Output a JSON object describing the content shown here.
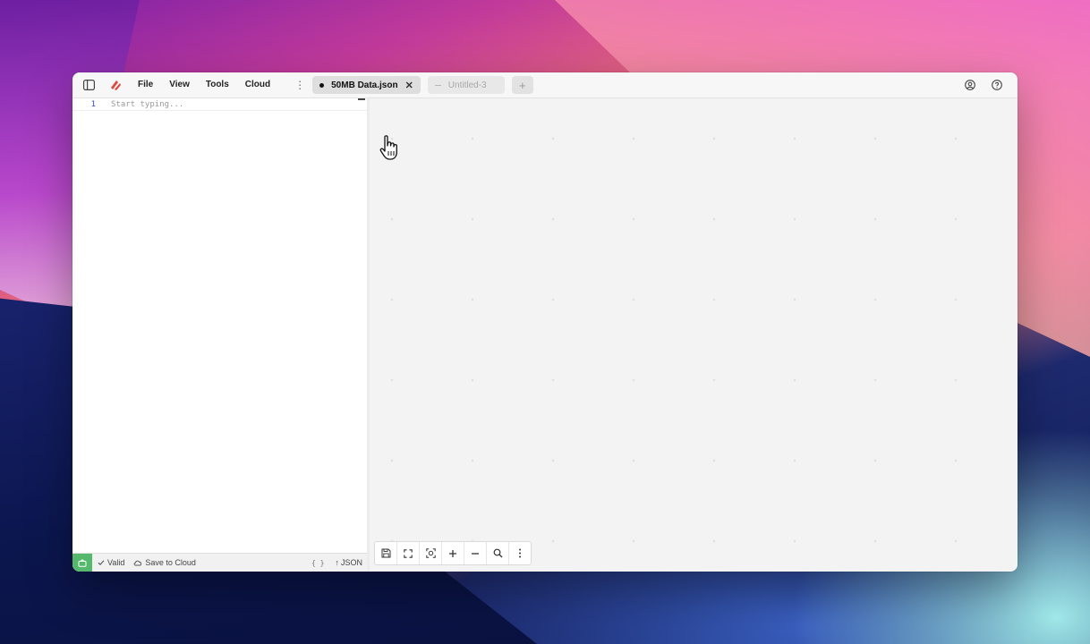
{
  "window": {
    "menu": [
      "File",
      "View",
      "Tools",
      "Cloud"
    ],
    "tabs": [
      {
        "label": "50MB Data.json",
        "active": true
      },
      {
        "label": "Untitled-3",
        "active": false
      }
    ]
  },
  "editor": {
    "line_numbers": [
      "1"
    ],
    "placeholder": "Start typing..."
  },
  "status": {
    "valid_label": "Valid",
    "save_label": "Save to Cloud",
    "braces": "{ }",
    "format_label": "JSON",
    "live_color": "#55b96d"
  },
  "canvas_toolbar": [
    "save-icon",
    "fullscreen-icon",
    "focus-icon",
    "zoom-in-icon",
    "zoom-out-icon",
    "search-icon",
    "more-icon"
  ],
  "icons": {
    "sidebar_toggle": "sidebar-icon",
    "logo": "logo-icon",
    "account": "user-circle-icon",
    "help": "help-circle-icon"
  }
}
